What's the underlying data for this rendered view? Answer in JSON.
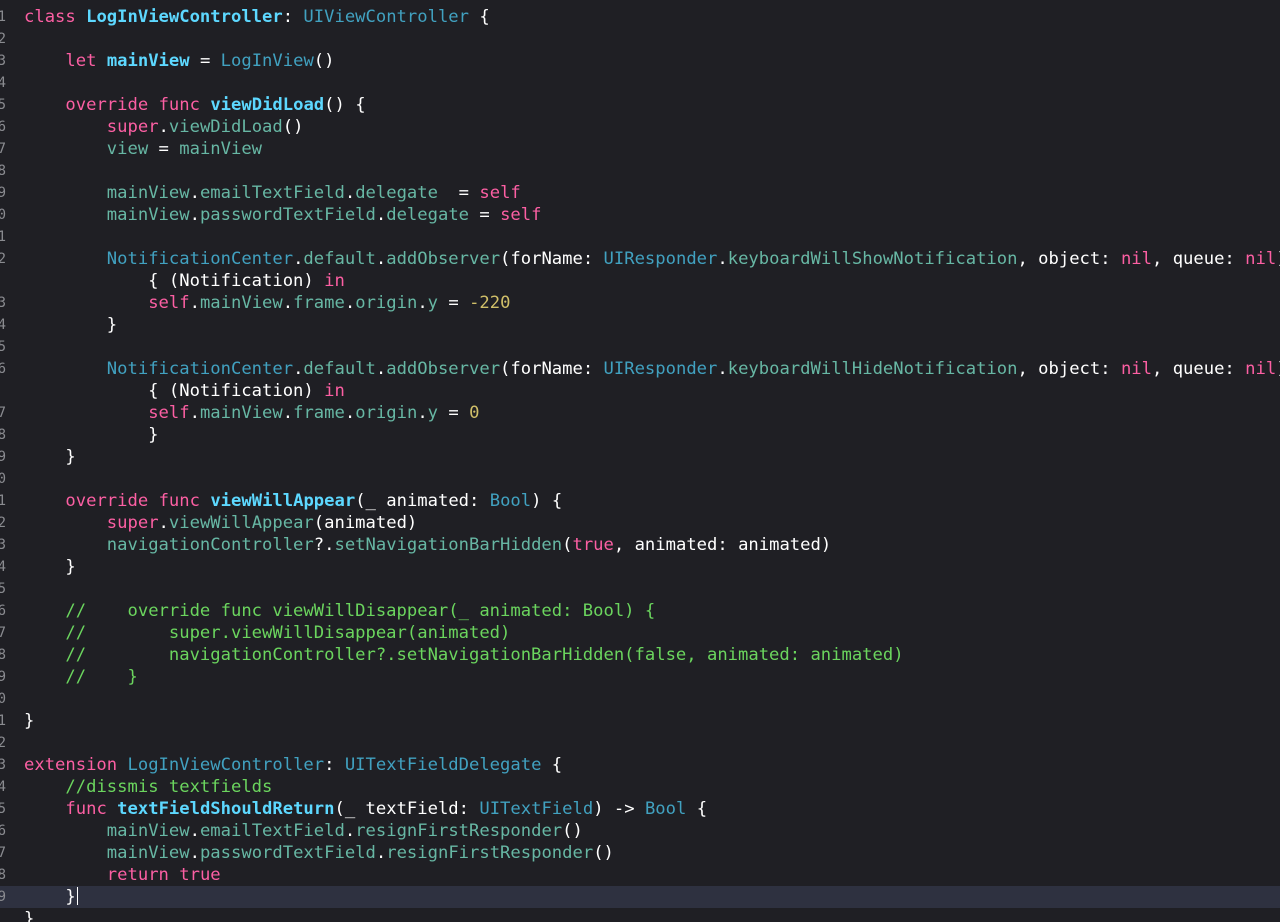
{
  "editor": {
    "language": "Swift",
    "colors": {
      "background": "#1f1f24",
      "current_line": "#2e3140",
      "keyword": "#fc5fa3",
      "declaration": "#5dd8ff",
      "type": "#41a1c0",
      "member": "#67b7a4",
      "number": "#d0bf69",
      "comment": "#6bd55e",
      "plain": "#ffffff",
      "line_number": "#8a8b90"
    },
    "cursor_line": 40,
    "lines": [
      {
        "n": "1",
        "tokens": [
          [
            "kw",
            "class"
          ],
          [
            "p",
            " "
          ],
          [
            "d",
            "LogInViewController"
          ],
          [
            "p",
            ": "
          ],
          [
            "t",
            "UIViewController"
          ],
          [
            "p",
            " {"
          ]
        ]
      },
      {
        "n": "2",
        "tokens": []
      },
      {
        "n": "3",
        "tokens": [
          [
            "p",
            "    "
          ],
          [
            "kw",
            "let"
          ],
          [
            "p",
            " "
          ],
          [
            "d",
            "mainView"
          ],
          [
            "p",
            " = "
          ],
          [
            "t",
            "LogInView"
          ],
          [
            "p",
            "()"
          ]
        ]
      },
      {
        "n": "4",
        "tokens": []
      },
      {
        "n": "5",
        "tokens": [
          [
            "p",
            "    "
          ],
          [
            "kw",
            "override"
          ],
          [
            "p",
            " "
          ],
          [
            "kw",
            "func"
          ],
          [
            "p",
            " "
          ],
          [
            "d",
            "viewDidLoad"
          ],
          [
            "p",
            "() {"
          ]
        ]
      },
      {
        "n": "6",
        "tokens": [
          [
            "p",
            "        "
          ],
          [
            "kw",
            "super"
          ],
          [
            "p",
            "."
          ],
          [
            "m",
            "viewDidLoad"
          ],
          [
            "p",
            "()"
          ]
        ]
      },
      {
        "n": "7",
        "tokens": [
          [
            "p",
            "        "
          ],
          [
            "m",
            "view"
          ],
          [
            "p",
            " = "
          ],
          [
            "m",
            "mainView"
          ]
        ]
      },
      {
        "n": "8",
        "tokens": []
      },
      {
        "n": "9",
        "tokens": [
          [
            "p",
            "        "
          ],
          [
            "m",
            "mainView"
          ],
          [
            "p",
            "."
          ],
          [
            "m",
            "emailTextField"
          ],
          [
            "p",
            "."
          ],
          [
            "m",
            "delegate"
          ],
          [
            "p",
            "  = "
          ],
          [
            "kw",
            "self"
          ]
        ]
      },
      {
        "n": "0",
        "tokens": [
          [
            "p",
            "        "
          ],
          [
            "m",
            "mainView"
          ],
          [
            "p",
            "."
          ],
          [
            "m",
            "passwordTextField"
          ],
          [
            "p",
            "."
          ],
          [
            "m",
            "delegate"
          ],
          [
            "p",
            " = "
          ],
          [
            "kw",
            "self"
          ]
        ]
      },
      {
        "n": "1",
        "tokens": []
      },
      {
        "n": "2",
        "tokens": [
          [
            "p",
            "        "
          ],
          [
            "t",
            "NotificationCenter"
          ],
          [
            "p",
            "."
          ],
          [
            "m",
            "default"
          ],
          [
            "p",
            "."
          ],
          [
            "m",
            "addObserver"
          ],
          [
            "p",
            "(forName: "
          ],
          [
            "t",
            "UIResponder"
          ],
          [
            "p",
            "."
          ],
          [
            "m",
            "keyboardWillShowNotification"
          ],
          [
            "p",
            ", object: "
          ],
          [
            "kw",
            "nil"
          ],
          [
            "p",
            ", queue: "
          ],
          [
            "kw",
            "nil"
          ],
          [
            "p",
            ")"
          ]
        ]
      },
      {
        "n": "",
        "tokens": [
          [
            "p",
            "            { (Notification) "
          ],
          [
            "kw",
            "in"
          ]
        ]
      },
      {
        "n": "3",
        "tokens": [
          [
            "p",
            "            "
          ],
          [
            "kw",
            "self"
          ],
          [
            "p",
            "."
          ],
          [
            "m",
            "mainView"
          ],
          [
            "p",
            "."
          ],
          [
            "m",
            "frame"
          ],
          [
            "p",
            "."
          ],
          [
            "m",
            "origin"
          ],
          [
            "p",
            "."
          ],
          [
            "m",
            "y"
          ],
          [
            "p",
            " = "
          ],
          [
            "num",
            "-220"
          ]
        ]
      },
      {
        "n": "4",
        "tokens": [
          [
            "p",
            "        }"
          ]
        ]
      },
      {
        "n": "5",
        "tokens": []
      },
      {
        "n": "6",
        "tokens": [
          [
            "p",
            "        "
          ],
          [
            "t",
            "NotificationCenter"
          ],
          [
            "p",
            "."
          ],
          [
            "m",
            "default"
          ],
          [
            "p",
            "."
          ],
          [
            "m",
            "addObserver"
          ],
          [
            "p",
            "(forName: "
          ],
          [
            "t",
            "UIResponder"
          ],
          [
            "p",
            "."
          ],
          [
            "m",
            "keyboardWillHideNotification"
          ],
          [
            "p",
            ", object: "
          ],
          [
            "kw",
            "nil"
          ],
          [
            "p",
            ", queue: "
          ],
          [
            "kw",
            "nil"
          ],
          [
            "p",
            ")"
          ]
        ]
      },
      {
        "n": "",
        "tokens": [
          [
            "p",
            "            { (Notification) "
          ],
          [
            "kw",
            "in"
          ]
        ]
      },
      {
        "n": "7",
        "tokens": [
          [
            "p",
            "            "
          ],
          [
            "kw",
            "self"
          ],
          [
            "p",
            "."
          ],
          [
            "m",
            "mainView"
          ],
          [
            "p",
            "."
          ],
          [
            "m",
            "frame"
          ],
          [
            "p",
            "."
          ],
          [
            "m",
            "origin"
          ],
          [
            "p",
            "."
          ],
          [
            "m",
            "y"
          ],
          [
            "p",
            " = "
          ],
          [
            "num",
            "0"
          ]
        ]
      },
      {
        "n": "8",
        "tokens": [
          [
            "p",
            "            }"
          ]
        ]
      },
      {
        "n": "9",
        "tokens": [
          [
            "p",
            "    }"
          ]
        ]
      },
      {
        "n": "0",
        "tokens": []
      },
      {
        "n": "1",
        "tokens": [
          [
            "p",
            "    "
          ],
          [
            "kw",
            "override"
          ],
          [
            "p",
            " "
          ],
          [
            "kw",
            "func"
          ],
          [
            "p",
            " "
          ],
          [
            "d",
            "viewWillAppear"
          ],
          [
            "p",
            "(_ animated: "
          ],
          [
            "t",
            "Bool"
          ],
          [
            "p",
            ") {"
          ]
        ]
      },
      {
        "n": "2",
        "tokens": [
          [
            "p",
            "        "
          ],
          [
            "kw",
            "super"
          ],
          [
            "p",
            "."
          ],
          [
            "m",
            "viewWillAppear"
          ],
          [
            "p",
            "(animated)"
          ]
        ]
      },
      {
        "n": "3",
        "tokens": [
          [
            "p",
            "        "
          ],
          [
            "m",
            "navigationController"
          ],
          [
            "p",
            "?."
          ],
          [
            "m",
            "setNavigationBarHidden"
          ],
          [
            "p",
            "("
          ],
          [
            "kw",
            "true"
          ],
          [
            "p",
            ", animated: animated)"
          ]
        ]
      },
      {
        "n": "4",
        "tokens": [
          [
            "p",
            "    }"
          ]
        ]
      },
      {
        "n": "5",
        "tokens": []
      },
      {
        "n": "6",
        "tokens": [
          [
            "p",
            "    "
          ],
          [
            "c",
            "//    override func viewWillDisappear(_ animated: Bool) {"
          ]
        ]
      },
      {
        "n": "7",
        "tokens": [
          [
            "p",
            "    "
          ],
          [
            "c",
            "//        super.viewWillDisappear(animated)"
          ]
        ]
      },
      {
        "n": "8",
        "tokens": [
          [
            "p",
            "    "
          ],
          [
            "c",
            "//        navigationController?.setNavigationBarHidden(false, animated: animated)"
          ]
        ]
      },
      {
        "n": "9",
        "tokens": [
          [
            "p",
            "    "
          ],
          [
            "c",
            "//    }"
          ]
        ]
      },
      {
        "n": "0",
        "tokens": []
      },
      {
        "n": "1",
        "tokens": [
          [
            "p",
            "}"
          ]
        ]
      },
      {
        "n": "2",
        "tokens": []
      },
      {
        "n": "3",
        "tokens": [
          [
            "kw",
            "extension"
          ],
          [
            "p",
            " "
          ],
          [
            "t",
            "LogInViewController"
          ],
          [
            "p",
            ": "
          ],
          [
            "t",
            "UITextFieldDelegate"
          ],
          [
            "p",
            " {"
          ]
        ]
      },
      {
        "n": "4",
        "tokens": [
          [
            "p",
            "    "
          ],
          [
            "c",
            "//dissmis textfields"
          ]
        ]
      },
      {
        "n": "5",
        "tokens": [
          [
            "p",
            "    "
          ],
          [
            "kw",
            "func"
          ],
          [
            "p",
            " "
          ],
          [
            "d",
            "textFieldShouldReturn"
          ],
          [
            "p",
            "(_ textField: "
          ],
          [
            "t",
            "UITextField"
          ],
          [
            "p",
            ") -> "
          ],
          [
            "t",
            "Bool"
          ],
          [
            "p",
            " {"
          ]
        ]
      },
      {
        "n": "6",
        "tokens": [
          [
            "p",
            "        "
          ],
          [
            "m",
            "mainView"
          ],
          [
            "p",
            "."
          ],
          [
            "m",
            "emailTextField"
          ],
          [
            "p",
            "."
          ],
          [
            "m",
            "resignFirstResponder"
          ],
          [
            "p",
            "()"
          ]
        ]
      },
      {
        "n": "7",
        "tokens": [
          [
            "p",
            "        "
          ],
          [
            "m",
            "mainView"
          ],
          [
            "p",
            "."
          ],
          [
            "m",
            "passwordTextField"
          ],
          [
            "p",
            "."
          ],
          [
            "m",
            "resignFirstResponder"
          ],
          [
            "p",
            "()"
          ]
        ]
      },
      {
        "n": "8",
        "tokens": [
          [
            "p",
            "        "
          ],
          [
            "kw",
            "return"
          ],
          [
            "p",
            " "
          ],
          [
            "kw",
            "true"
          ]
        ]
      },
      {
        "n": "9",
        "tokens": [
          [
            "p",
            "    }"
          ]
        ]
      },
      {
        "n": "",
        "tokens": [
          [
            "p",
            "}"
          ]
        ]
      }
    ]
  }
}
